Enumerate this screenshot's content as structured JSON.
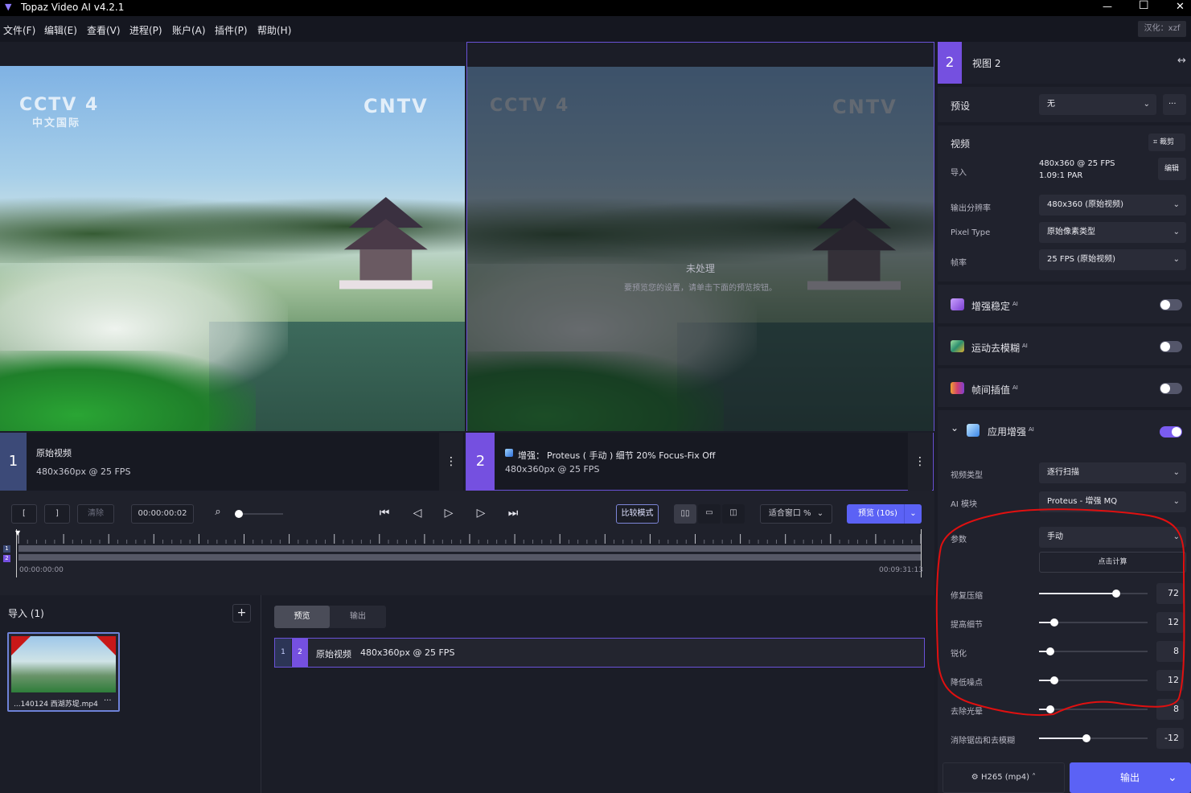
{
  "window": {
    "title": "Topaz Video AI  v4.2.1",
    "min": "—",
    "max": "☐",
    "close": "✕"
  },
  "menu": {
    "items": [
      "文件(F)",
      "编辑(E)",
      "查看(V)",
      "进程(P)",
      "账户(A)",
      "插件(P)",
      "帮助(H)"
    ],
    "localize_badge": "汉化：xzf"
  },
  "viewer": {
    "left_logo_main": "CCTV 4",
    "left_logo_sub": "中文国际",
    "right_logo": "CNTV",
    "unprocessed_title": "未处理",
    "unprocessed_hint": "要预览您的设置，请单击下面的预览按钮。",
    "pane1": {
      "num": "1",
      "name": "原始视频",
      "spec": "480x360px @ 25 FPS"
    },
    "pane2": {
      "num": "2",
      "enh_prefix": "增强：",
      "enh_desc": "Proteus ( 手动 ) 细节 20% Focus-Fix Off",
      "spec": "480x360px @ 25 FPS"
    }
  },
  "transport": {
    "mark_in": "[",
    "mark_out": "]",
    "clear": "清除",
    "timecode": "00:00:00:02",
    "compare_mode": "比较模式",
    "fit_window": "适合窗口 %",
    "preview_btn": "预览 (10s)",
    "time_start": "00:00:00:00",
    "time_end": "00:09:31:13",
    "track1": "1",
    "track2": "2"
  },
  "imports": {
    "header": "导入 (1)",
    "add": "+",
    "file_name": "...140124 西湖苏堤.mp4",
    "file_more": "···"
  },
  "queue": {
    "tab_preview": "预览",
    "tab_output": "输出",
    "row_num1": "1",
    "row_num2": "2",
    "row_name": "原始视频",
    "row_spec": "480x360px @ 25 FPS"
  },
  "panel": {
    "view_num": "2",
    "view_title": "视图 2",
    "expand_icon": "↔",
    "preset_label": "预设",
    "preset_value": "无",
    "preset_more": "···",
    "video_label": "视频",
    "crop_label": "裁剪",
    "import_label": "导入",
    "import_res": "480x360 @ 25 FPS",
    "import_par": "1.09:1 PAR",
    "edit_label": "编辑",
    "out_res_label": "输出分辨率",
    "out_res_value": "480x360 (原始视频)",
    "pixel_type_label": "Pixel Type",
    "pixel_type_value": "原始像素类型",
    "fps_label": "帧率",
    "fps_value": "25 FPS (原始视频)",
    "stabilize": "增强稳定",
    "deblur": "运动去模糊",
    "interp": "帧间插值",
    "enhance": "应用增强",
    "ai_mark": "AI",
    "video_type_label": "视频类型",
    "video_type_value": "逐行扫描",
    "ai_model_label": "AI 模块",
    "ai_model_value": "Proteus - 增强 MQ",
    "params_label": "参数",
    "params_value": "手动",
    "auto_calc": "点击计算",
    "sliders": [
      {
        "label": "修复压缩",
        "value": "72",
        "frac": 0.71
      },
      {
        "label": "提高细节",
        "value": "12",
        "frac": 0.14
      },
      {
        "label": "锐化",
        "value": "8",
        "frac": 0.1
      },
      {
        "label": "降低噪点",
        "value": "12",
        "frac": 0.14
      },
      {
        "label": "去除光晕",
        "value": "8",
        "frac": 0.1
      },
      {
        "label": "消除锯齿和去模糊",
        "value": "-12",
        "frac": 0.44
      }
    ],
    "codec": "H265 (mp4)",
    "export_btn": "输出"
  },
  "colors": {
    "accent": "#7a5cf0",
    "pane1": "#3c4a78",
    "pane2": "#7550e0",
    "annotation": "#e01010",
    "primary_btn": "#5b62f5"
  }
}
